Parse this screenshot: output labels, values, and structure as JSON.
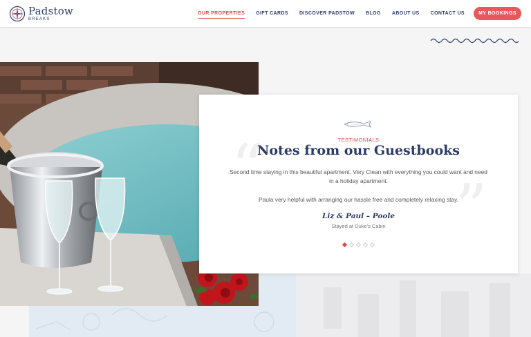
{
  "brand": {
    "name": "Padstow",
    "tagline": "BREAKS"
  },
  "nav": {
    "items": [
      {
        "label": "OUR PROPERTIES",
        "active": true
      },
      {
        "label": "GIFT CARDS",
        "active": false
      },
      {
        "label": "DISCOVER PADSTOW",
        "active": false
      },
      {
        "label": "BLOG",
        "active": false
      },
      {
        "label": "ABOUT US",
        "active": false
      },
      {
        "label": "CONTACT US",
        "active": false
      }
    ],
    "cta_label": "MY BOOKINGS"
  },
  "testimonials": {
    "kicker": "TESTIMONIALS",
    "heading": "Notes from our Guestbooks",
    "paragraphs": [
      "Second time staying in this beautiful apartment. Very Clean with everything you could want and need in a holiday apartment.",
      "Paula very helpful with arranging our hassle free and completely relaxing stay."
    ],
    "author": "Liz & Paul – Poole",
    "stayed_at": "Stayed at Duke's Cabin",
    "slide_count": 5,
    "active_slide": 0
  },
  "colors": {
    "accent": "#e04a4f",
    "navy": "#2b3b66",
    "background": "#f5f5f6"
  },
  "icons": {
    "logo": "compass-rose-icon",
    "divider": "fish-icon",
    "quote_open": "open-quote-icon",
    "quote_close": "close-quote-icon"
  }
}
